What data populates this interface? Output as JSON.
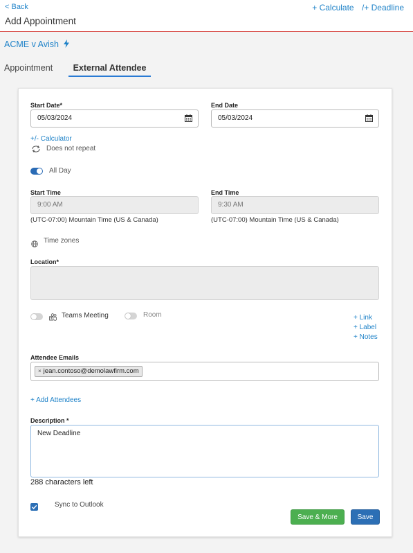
{
  "header": {
    "back_label": "< Back",
    "calculate_label": "+ Calculate",
    "deadline_label": "/+ Deadline",
    "title": "Add Appointment"
  },
  "matter": {
    "name": "ACME v Avish",
    "icon": "lightning-icon"
  },
  "tabs": [
    {
      "label": "Appointment",
      "active": false
    },
    {
      "label": "External Attendee",
      "active": true
    }
  ],
  "form": {
    "start_date_label": "Start Date*",
    "start_date_value": "05/03/2024",
    "end_date_label": "End Date",
    "end_date_value": "05/03/2024",
    "calculator_link": "+/- Calculator",
    "repeat_label": "Does not repeat",
    "all_day_label": "All Day",
    "all_day_on": true,
    "start_time_label": "Start Time",
    "start_time_value": "9:00 AM",
    "start_tz": "(UTC-07:00) Mountain Time (US & Canada)",
    "end_time_label": "End Time",
    "end_time_value": "9:30 AM",
    "end_tz": "(UTC-07:00) Mountain Time (US & Canada)",
    "time_zones_label": "Time zones",
    "location_label": "Location*",
    "location_value": "",
    "teams_meeting_label": "Teams Meeting",
    "room_label": "Room",
    "link_label": "+ Link",
    "label_label": "+ Label",
    "notes_label": "+ Notes",
    "attendee_emails_label": "Attendee Emails",
    "attendees": [
      "jean.contoso@demolawfirm.com"
    ],
    "add_attendees_label": "+ Add Attendees",
    "description_label": "Description *",
    "description_value": "New Deadline",
    "chars_left": "288 characters left",
    "sync_label": "Sync to Outlook",
    "sync_checked": true,
    "save_more_label": "Save & More",
    "save_label": "Save"
  },
  "colors": {
    "link_blue": "#1e82c8",
    "header_divider": "#d9534f",
    "save_more_green": "#4caf50",
    "save_blue": "#2c6fb5",
    "toggle_on": "#2a6bb5"
  }
}
